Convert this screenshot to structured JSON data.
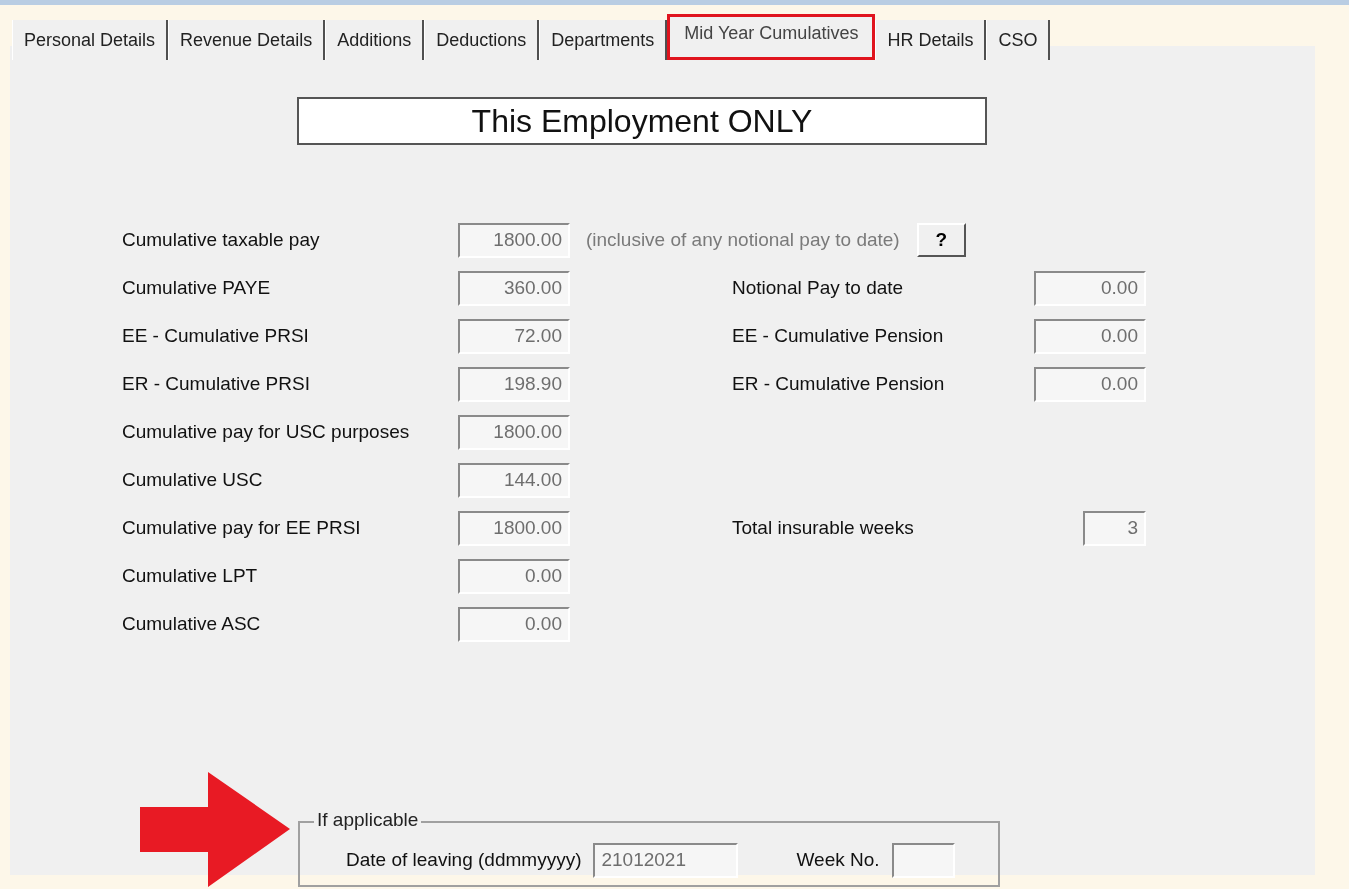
{
  "tabs": [
    {
      "label": "Personal Details",
      "selected": false
    },
    {
      "label": "Revenue Details",
      "selected": false
    },
    {
      "label": "Additions",
      "selected": false
    },
    {
      "label": "Deductions",
      "selected": false
    },
    {
      "label": "Departments",
      "selected": false
    },
    {
      "label": "Mid Year Cumulatives",
      "selected": true
    },
    {
      "label": "HR Details",
      "selected": false
    },
    {
      "label": "CSO",
      "selected": false
    }
  ],
  "heading": "This Employment ONLY",
  "left_fields": [
    {
      "label": "Cumulative taxable pay",
      "value": "1800.00"
    },
    {
      "label": "Cumulative PAYE",
      "value": "360.00"
    },
    {
      "label": "EE - Cumulative PRSI",
      "value": "72.00"
    },
    {
      "label": "ER - Cumulative PRSI",
      "value": "198.90"
    },
    {
      "label": "Cumulative pay for USC purposes",
      "value": "1800.00"
    },
    {
      "label": "Cumulative USC",
      "value": "144.00"
    },
    {
      "label": "Cumulative pay for EE PRSI",
      "value": "1800.00"
    },
    {
      "label": "Cumulative LPT",
      "value": "0.00"
    },
    {
      "label": "Cumulative ASC",
      "value": "0.00"
    }
  ],
  "hint": "(inclusive of any notional pay to date)",
  "help_button": "?",
  "right_fields": [
    {
      "label": "Notional Pay to date",
      "value": "0.00"
    },
    {
      "label": "EE - Cumulative Pension",
      "value": "0.00"
    },
    {
      "label": "ER - Cumulative Pension",
      "value": "0.00"
    }
  ],
  "insurable_weeks": {
    "label": "Total insurable weeks",
    "value": "3"
  },
  "leaving_group": {
    "title": "If applicable",
    "date_label": "Date of leaving (ddmmyyyy)",
    "date_value": "21012021",
    "week_label": "Week No."
  }
}
